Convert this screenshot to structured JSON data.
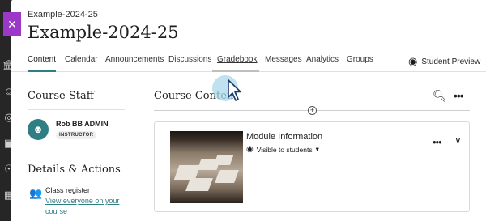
{
  "header": {
    "course_id": "Example-2024-25",
    "course_title": "Example-2024-25"
  },
  "tabs": [
    {
      "label": "Content"
    },
    {
      "label": "Calendar"
    },
    {
      "label": "Announcements"
    },
    {
      "label": "Discussions"
    },
    {
      "label": "Gradebook"
    },
    {
      "label": "Messages"
    },
    {
      "label": "Analytics"
    },
    {
      "label": "Groups"
    }
  ],
  "student_preview_label": "Student Preview",
  "course_staff": {
    "title": "Course Staff",
    "name": "Rob BB ADMIN",
    "role": "INSTRUCTOR"
  },
  "details": {
    "title": "Details & Actions",
    "register_label": "Class register",
    "register_link": "View everyone on your course"
  },
  "course_content": {
    "title": "Course Content",
    "module_title": "Module Information",
    "visibility": "Visible to students"
  },
  "icons": {
    "close": "close-icon",
    "student_preview": "eye-icon",
    "search": "search-icon",
    "more": "more-options-icon",
    "add": "add-icon",
    "chevron": "chevron-down-icon"
  },
  "colors": {
    "accent": "#2f7e84",
    "close_tab": "#9b38c7",
    "nav_rail": "#262626"
  }
}
